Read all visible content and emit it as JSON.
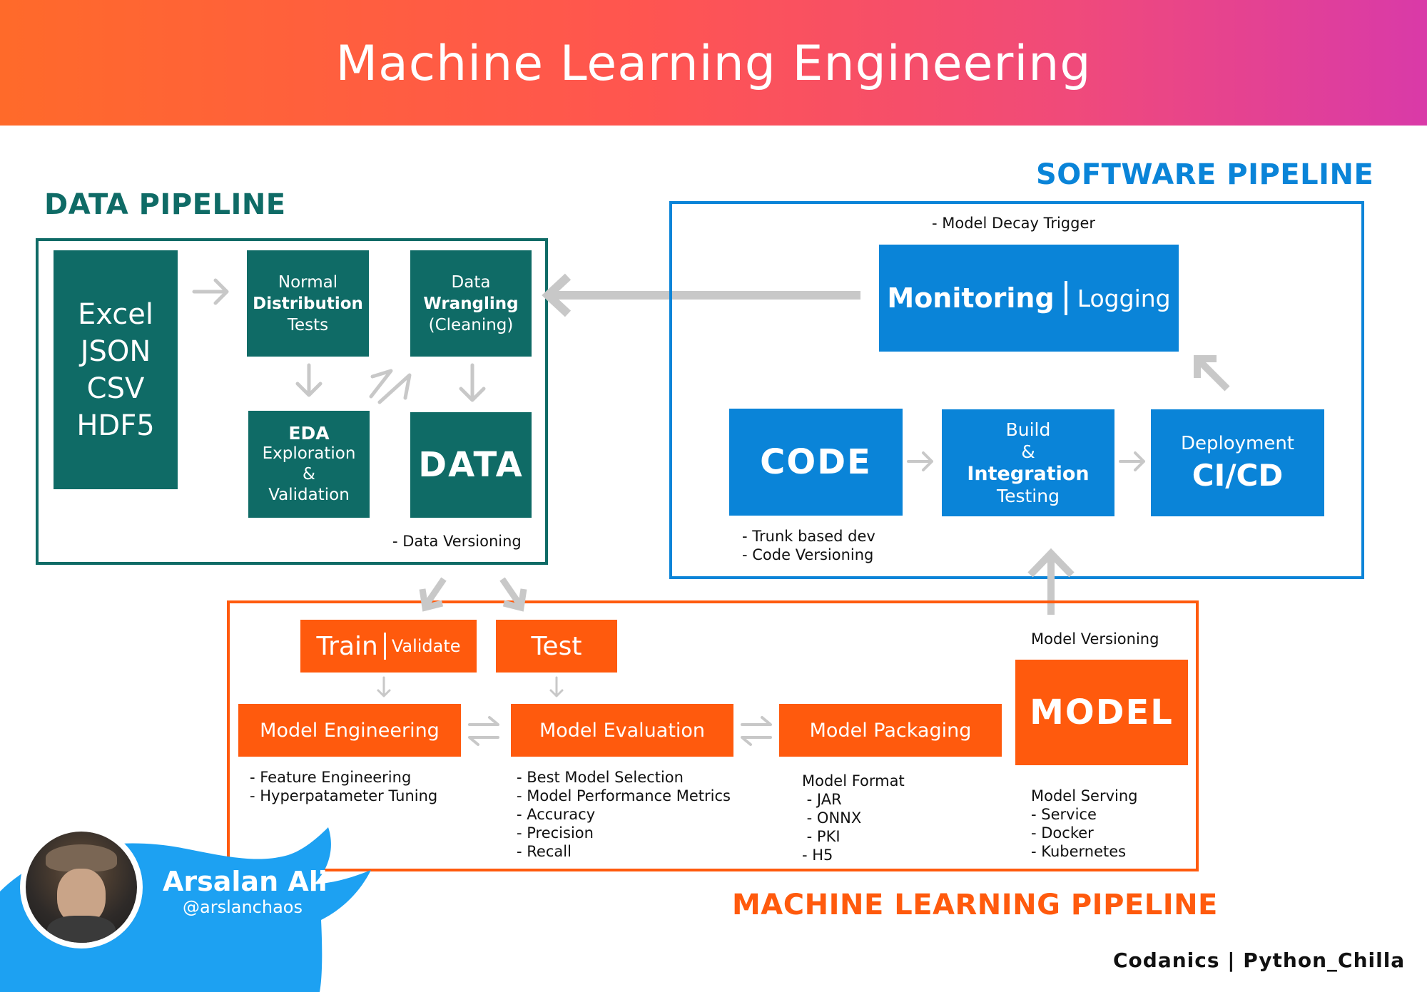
{
  "header": {
    "title": "Machine Learning Engineering"
  },
  "data_pipeline": {
    "title": "DATA PIPELINE",
    "formats": [
      "Excel",
      "JSON",
      "CSV",
      "HDF5"
    ],
    "normal_dist": {
      "line1": "Normal",
      "line2": "Distribution",
      "line3": "Tests"
    },
    "wrangling": {
      "line1": "Data",
      "line2": "Wrangling",
      "line3": "(Cleaning)"
    },
    "eda": {
      "line1": "EDA",
      "line2": "Exploration",
      "line3": "&",
      "line4": "Validation"
    },
    "data_box": "DATA",
    "note": "- Data Versioning"
  },
  "software_pipeline": {
    "title": "SOFTWARE PIPELINE",
    "trigger_note": "- Model Decay Trigger",
    "monitoring": {
      "left": "Monitoring",
      "right": "Logging"
    },
    "code": "CODE",
    "code_notes": [
      "- Trunk based dev",
      "- Code Versioning"
    ],
    "build": {
      "line1": "Build",
      "line2": "&",
      "line3": "Integration",
      "line4": "Testing"
    },
    "deploy": {
      "line1": "Deployment",
      "line2": "CI/CD"
    }
  },
  "ml_pipeline": {
    "title": "MACHINE LEARNING PIPELINE",
    "train": {
      "left": "Train",
      "right": "Validate"
    },
    "test": "Test",
    "model_versioning": "Model Versioning",
    "model": "MODEL",
    "model_engineering": "Model Engineering",
    "model_evaluation": "Model Evaluation",
    "model_packaging": "Model Packaging",
    "eng_notes": [
      "- Feature Engineering",
      "- Hyperpatameter Tuning"
    ],
    "eval_notes": [
      "- Best Model Selection",
      "- Model Performance Metrics",
      "- Accuracy",
      "- Precision",
      "- Recall"
    ],
    "format_notes": [
      "Model Format",
      " - JAR",
      " - ONNX",
      " - PKI",
      "- H5"
    ],
    "serving_notes": [
      "Model Serving",
      "- Service",
      "- Docker",
      "- Kubernetes"
    ]
  },
  "author": {
    "name": "Arsalan Ali",
    "handle": "@arslanchaos"
  },
  "footer": {
    "credit": "Codanics | Python_Chilla"
  },
  "colors": {
    "teal": "#0f6b66",
    "blue": "#0a84d8",
    "orange": "#ff5a0d",
    "arrow": "#c8c8c8",
    "twitter": "#1da1f2"
  }
}
